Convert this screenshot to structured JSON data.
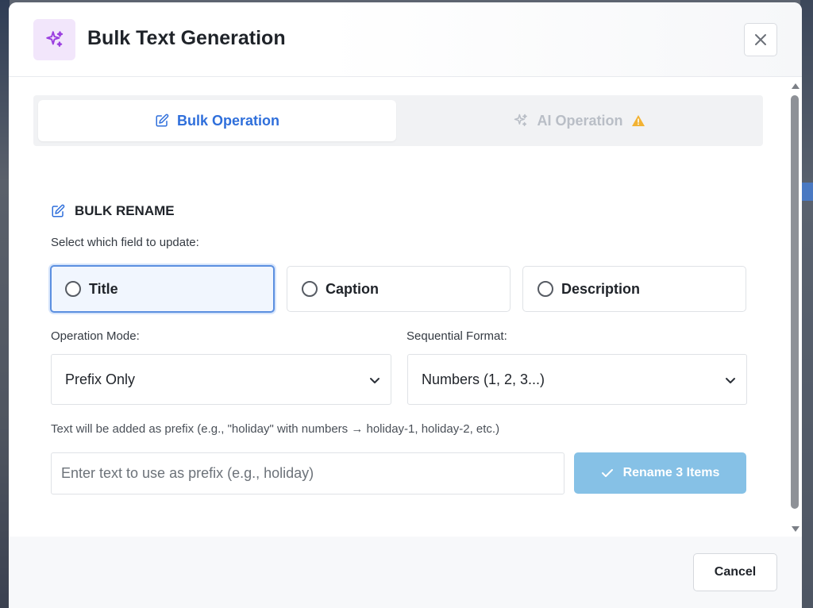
{
  "modal": {
    "title": "Bulk Text Generation",
    "header_icon": "sparkles-icon",
    "close_icon": "close-icon"
  },
  "tabs": [
    {
      "label": "Bulk Operation",
      "icon": "edit-icon",
      "active": true
    },
    {
      "label": "AI Operation",
      "icon": "sparkles-icon",
      "badge_icon": "warning-icon",
      "active": false
    }
  ],
  "bulk_rename": {
    "section_title": "BULK RENAME",
    "section_icon": "edit-icon",
    "field_prompt": "Select which field to update:",
    "field_options": [
      {
        "label": "Title",
        "selected": false,
        "highlighted": true
      },
      {
        "label": "Caption",
        "selected": false,
        "highlighted": false
      },
      {
        "label": "Description",
        "selected": false,
        "highlighted": false
      }
    ],
    "operation_mode_label": "Operation Mode:",
    "operation_mode_value": "Prefix Only",
    "sequential_format_label": "Sequential Format:",
    "sequential_format_value": "Numbers (1, 2, 3...)",
    "hint": "Text will be added as prefix (e.g., \"holiday\" with numbers → holiday-1, holiday-2, etc.)",
    "input_placeholder": "Enter text to use as prefix (e.g., holiday)",
    "input_value": "",
    "rename_button_label": "Rename 3 Items"
  },
  "footer": {
    "cancel_label": "Cancel"
  },
  "colors": {
    "accent_blue": "#2f6fdb",
    "selected_border": "#5b8fe0",
    "rename_button_bg": "#86c1e6",
    "header_icon_bg": "#f2e6fb",
    "header_icon_color": "#9b3fe0",
    "warning": "#f2b233"
  }
}
